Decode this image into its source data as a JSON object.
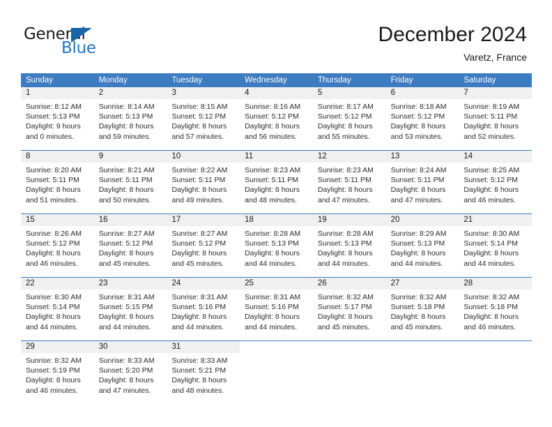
{
  "brand": {
    "name_top": "General",
    "name_bottom": "Blue",
    "accent_color": "#2176bd",
    "triangle_color": "#1565a8"
  },
  "header": {
    "title": "December 2024",
    "location": "Varetz, France"
  },
  "calendar": {
    "header_bg": "#3d7cc0",
    "weekdays": [
      "Sunday",
      "Monday",
      "Tuesday",
      "Wednesday",
      "Thursday",
      "Friday",
      "Saturday"
    ],
    "weeks": [
      [
        {
          "day": "1",
          "sunrise": "Sunrise: 8:12 AM",
          "sunset": "Sunset: 5:13 PM",
          "daylight_line1": "Daylight: 9 hours",
          "daylight_line2": "and 0 minutes."
        },
        {
          "day": "2",
          "sunrise": "Sunrise: 8:14 AM",
          "sunset": "Sunset: 5:13 PM",
          "daylight_line1": "Daylight: 8 hours",
          "daylight_line2": "and 59 minutes."
        },
        {
          "day": "3",
          "sunrise": "Sunrise: 8:15 AM",
          "sunset": "Sunset: 5:12 PM",
          "daylight_line1": "Daylight: 8 hours",
          "daylight_line2": "and 57 minutes."
        },
        {
          "day": "4",
          "sunrise": "Sunrise: 8:16 AM",
          "sunset": "Sunset: 5:12 PM",
          "daylight_line1": "Daylight: 8 hours",
          "daylight_line2": "and 56 minutes."
        },
        {
          "day": "5",
          "sunrise": "Sunrise: 8:17 AM",
          "sunset": "Sunset: 5:12 PM",
          "daylight_line1": "Daylight: 8 hours",
          "daylight_line2": "and 55 minutes."
        },
        {
          "day": "6",
          "sunrise": "Sunrise: 8:18 AM",
          "sunset": "Sunset: 5:12 PM",
          "daylight_line1": "Daylight: 8 hours",
          "daylight_line2": "and 53 minutes."
        },
        {
          "day": "7",
          "sunrise": "Sunrise: 8:19 AM",
          "sunset": "Sunset: 5:11 PM",
          "daylight_line1": "Daylight: 8 hours",
          "daylight_line2": "and 52 minutes."
        }
      ],
      [
        {
          "day": "8",
          "sunrise": "Sunrise: 8:20 AM",
          "sunset": "Sunset: 5:11 PM",
          "daylight_line1": "Daylight: 8 hours",
          "daylight_line2": "and 51 minutes."
        },
        {
          "day": "9",
          "sunrise": "Sunrise: 8:21 AM",
          "sunset": "Sunset: 5:11 PM",
          "daylight_line1": "Daylight: 8 hours",
          "daylight_line2": "and 50 minutes."
        },
        {
          "day": "10",
          "sunrise": "Sunrise: 8:22 AM",
          "sunset": "Sunset: 5:11 PM",
          "daylight_line1": "Daylight: 8 hours",
          "daylight_line2": "and 49 minutes."
        },
        {
          "day": "11",
          "sunrise": "Sunrise: 8:23 AM",
          "sunset": "Sunset: 5:11 PM",
          "daylight_line1": "Daylight: 8 hours",
          "daylight_line2": "and 48 minutes."
        },
        {
          "day": "12",
          "sunrise": "Sunrise: 8:23 AM",
          "sunset": "Sunset: 5:11 PM",
          "daylight_line1": "Daylight: 8 hours",
          "daylight_line2": "and 47 minutes."
        },
        {
          "day": "13",
          "sunrise": "Sunrise: 8:24 AM",
          "sunset": "Sunset: 5:11 PM",
          "daylight_line1": "Daylight: 8 hours",
          "daylight_line2": "and 47 minutes."
        },
        {
          "day": "14",
          "sunrise": "Sunrise: 8:25 AM",
          "sunset": "Sunset: 5:12 PM",
          "daylight_line1": "Daylight: 8 hours",
          "daylight_line2": "and 46 minutes."
        }
      ],
      [
        {
          "day": "15",
          "sunrise": "Sunrise: 8:26 AM",
          "sunset": "Sunset: 5:12 PM",
          "daylight_line1": "Daylight: 8 hours",
          "daylight_line2": "and 46 minutes."
        },
        {
          "day": "16",
          "sunrise": "Sunrise: 8:27 AM",
          "sunset": "Sunset: 5:12 PM",
          "daylight_line1": "Daylight: 8 hours",
          "daylight_line2": "and 45 minutes."
        },
        {
          "day": "17",
          "sunrise": "Sunrise: 8:27 AM",
          "sunset": "Sunset: 5:12 PM",
          "daylight_line1": "Daylight: 8 hours",
          "daylight_line2": "and 45 minutes."
        },
        {
          "day": "18",
          "sunrise": "Sunrise: 8:28 AM",
          "sunset": "Sunset: 5:13 PM",
          "daylight_line1": "Daylight: 8 hours",
          "daylight_line2": "and 44 minutes."
        },
        {
          "day": "19",
          "sunrise": "Sunrise: 8:28 AM",
          "sunset": "Sunset: 5:13 PM",
          "daylight_line1": "Daylight: 8 hours",
          "daylight_line2": "and 44 minutes."
        },
        {
          "day": "20",
          "sunrise": "Sunrise: 8:29 AM",
          "sunset": "Sunset: 5:13 PM",
          "daylight_line1": "Daylight: 8 hours",
          "daylight_line2": "and 44 minutes."
        },
        {
          "day": "21",
          "sunrise": "Sunrise: 8:30 AM",
          "sunset": "Sunset: 5:14 PM",
          "daylight_line1": "Daylight: 8 hours",
          "daylight_line2": "and 44 minutes."
        }
      ],
      [
        {
          "day": "22",
          "sunrise": "Sunrise: 8:30 AM",
          "sunset": "Sunset: 5:14 PM",
          "daylight_line1": "Daylight: 8 hours",
          "daylight_line2": "and 44 minutes."
        },
        {
          "day": "23",
          "sunrise": "Sunrise: 8:31 AM",
          "sunset": "Sunset: 5:15 PM",
          "daylight_line1": "Daylight: 8 hours",
          "daylight_line2": "and 44 minutes."
        },
        {
          "day": "24",
          "sunrise": "Sunrise: 8:31 AM",
          "sunset": "Sunset: 5:16 PM",
          "daylight_line1": "Daylight: 8 hours",
          "daylight_line2": "and 44 minutes."
        },
        {
          "day": "25",
          "sunrise": "Sunrise: 8:31 AM",
          "sunset": "Sunset: 5:16 PM",
          "daylight_line1": "Daylight: 8 hours",
          "daylight_line2": "and 44 minutes."
        },
        {
          "day": "26",
          "sunrise": "Sunrise: 8:32 AM",
          "sunset": "Sunset: 5:17 PM",
          "daylight_line1": "Daylight: 8 hours",
          "daylight_line2": "and 45 minutes."
        },
        {
          "day": "27",
          "sunrise": "Sunrise: 8:32 AM",
          "sunset": "Sunset: 5:18 PM",
          "daylight_line1": "Daylight: 8 hours",
          "daylight_line2": "and 45 minutes."
        },
        {
          "day": "28",
          "sunrise": "Sunrise: 8:32 AM",
          "sunset": "Sunset: 5:18 PM",
          "daylight_line1": "Daylight: 8 hours",
          "daylight_line2": "and 46 minutes."
        }
      ],
      [
        {
          "day": "29",
          "sunrise": "Sunrise: 8:32 AM",
          "sunset": "Sunset: 5:19 PM",
          "daylight_line1": "Daylight: 8 hours",
          "daylight_line2": "and 46 minutes."
        },
        {
          "day": "30",
          "sunrise": "Sunrise: 8:33 AM",
          "sunset": "Sunset: 5:20 PM",
          "daylight_line1": "Daylight: 8 hours",
          "daylight_line2": "and 47 minutes."
        },
        {
          "day": "31",
          "sunrise": "Sunrise: 8:33 AM",
          "sunset": "Sunset: 5:21 PM",
          "daylight_line1": "Daylight: 8 hours",
          "daylight_line2": "and 48 minutes."
        },
        {
          "day": "",
          "sunrise": "",
          "sunset": "",
          "daylight_line1": "",
          "daylight_line2": ""
        },
        {
          "day": "",
          "sunrise": "",
          "sunset": "",
          "daylight_line1": "",
          "daylight_line2": ""
        },
        {
          "day": "",
          "sunrise": "",
          "sunset": "",
          "daylight_line1": "",
          "daylight_line2": ""
        },
        {
          "day": "",
          "sunrise": "",
          "sunset": "",
          "daylight_line1": "",
          "daylight_line2": ""
        }
      ]
    ]
  }
}
